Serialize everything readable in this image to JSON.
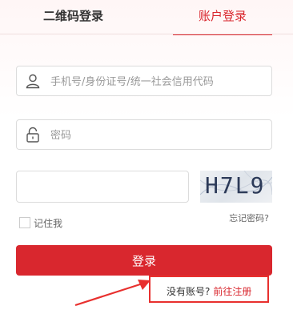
{
  "tabs": [
    {
      "label": "二维码登录",
      "active": false
    },
    {
      "label": "账户登录",
      "active": true
    }
  ],
  "form": {
    "username": {
      "placeholder": "手机号/身份证号/统一社会信用代码",
      "value": "",
      "icon": "user-icon"
    },
    "password": {
      "placeholder": "密码",
      "value": "",
      "icon": "lock-icon"
    },
    "captcha": {
      "value": "",
      "image_text": "H7L9"
    },
    "remember_label": "记住我",
    "forgot_label": "忘记密码?",
    "login_label": "登录"
  },
  "register": {
    "question": "没有账号?",
    "link_label": "前往注册"
  },
  "colors": {
    "accent": "#d9272e",
    "highlight": "#e8302e"
  }
}
